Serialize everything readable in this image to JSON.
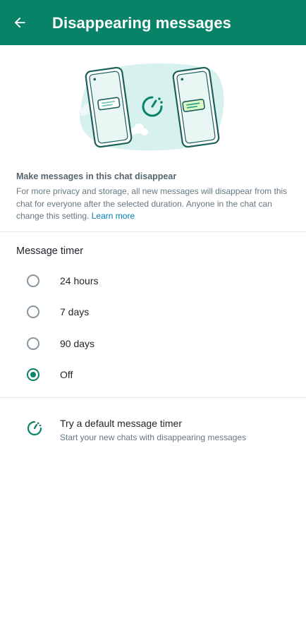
{
  "header": {
    "title": "Disappearing messages",
    "back_icon": "arrow-left-icon"
  },
  "info": {
    "heading": "Make messages in this chat disappear",
    "description": "For more privacy and storage, all new messages will disappear from this chat for everyone after the selected duration. Anyone in the chat can change this setting.",
    "learn_more": "Learn more"
  },
  "timer": {
    "label": "Message timer",
    "options": [
      {
        "label": "24 hours",
        "selected": false
      },
      {
        "label": "7 days",
        "selected": false
      },
      {
        "label": "90 days",
        "selected": false
      },
      {
        "label": "Off",
        "selected": true
      }
    ]
  },
  "default_timer": {
    "title": "Try a default message timer",
    "subtitle": "Start your new chats with disappearing messages",
    "icon": "timer-icon"
  },
  "colors": {
    "accent": "#088368",
    "link": "#027eb5"
  }
}
